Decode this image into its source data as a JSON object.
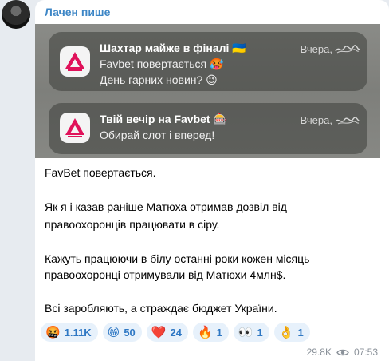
{
  "message": {
    "sender": "Лачен пише",
    "notifications": [
      {
        "title": "Шахтар майже в фіналі 🇺🇦",
        "lines": [
          "Favbet повертається 🥵",
          "День гарних новин? 😉"
        ],
        "time": "Вчера,"
      },
      {
        "title": "Твій вечір на Favbet 🎰",
        "lines": [
          "Обирай слот і вперед!"
        ],
        "time": "Вчера,"
      }
    ],
    "paragraphs": [
      "FavBet повертається.",
      "Як я і казав раніше Матюха отримав дозвіл від",
      "правоохоронців працювати в сіру.",
      "Кажуть працюючи в білу останні роки кожен місяць",
      "правоохоронці отримували від Матюхи 4млн$.",
      "Всі заробляють, а страждає бюджет України."
    ],
    "reactions": [
      {
        "emoji": "🤬",
        "count": "1.11K"
      },
      {
        "emoji": "😁",
        "count": "50"
      },
      {
        "emoji": "❤️",
        "count": "24"
      },
      {
        "emoji": "🔥",
        "count": "1"
      },
      {
        "emoji": "👀",
        "count": "1"
      },
      {
        "emoji": "👌",
        "count": "1"
      }
    ],
    "views": "29.8K",
    "time": "07:53"
  },
  "icons": {
    "app_icon": "favbet-app-icon",
    "views_icon": "eye-icon"
  },
  "colors": {
    "sender": "#3d86c6",
    "reaction_bg": "#e7f1fb",
    "reaction_text": "#2f78c4",
    "app_logo": "#e0125a"
  }
}
